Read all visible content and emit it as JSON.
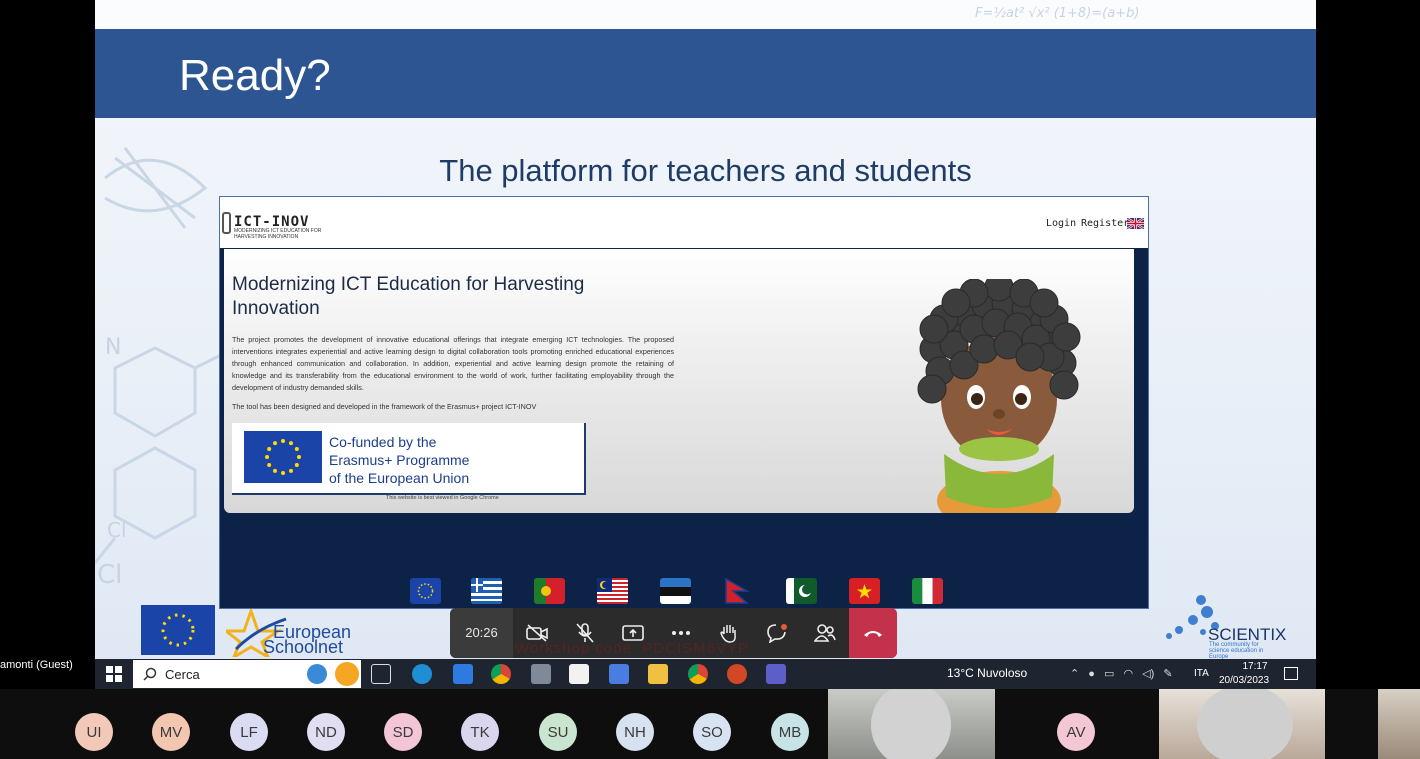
{
  "slide": {
    "title": "Ready?",
    "subtitle": "The platform for teachers and students",
    "decor": {
      "formula_top": "F=½at²  √x²  (1+8)=(a+b)",
      "chem_cl1": "Cl",
      "chem_cl2": "Cl",
      "chem_n": "N"
    }
  },
  "website": {
    "logo_title": "ICT-INOV",
    "logo_subtitle": "MODERNIZING ICT EDUCATION FOR HARVESTING INNOVATION",
    "nav": {
      "login": "Login",
      "register": "Register"
    },
    "hero": {
      "heading": "Modernizing ICT Education for Harvesting Innovation",
      "paragraph1": "The project promotes the development of innovative educational offerings that integrate emerging ICT technologies. The proposed interventions integrates experiential and active learning design to digital collaboration tools promoting enriched educational experiences through enhanced communication and collaboration. In addition, experiential and active learning design promote the retaining of knowledge and its transferability from the educational environment to the world of work, further facilitating employability through the development of industry demanded skills.",
      "paragraph2": "The tool has been designed and developed in the framework of the Erasmus+ project ICT-INOV",
      "cofund_line1": "Co-funded by the",
      "cofund_line2": "Erasmus+ Programme",
      "cofund_line3": "of the European Union",
      "note": "This website is best viewed in Google Chrome"
    },
    "flags": [
      "eu",
      "greece",
      "portugal",
      "malaysia",
      "estonia",
      "nepal",
      "pakistan",
      "vietnam",
      "italy"
    ]
  },
  "footer_logos": {
    "eun_line1": "European",
    "eun_line2": "Schoolnet",
    "scientix": "SCIENTIX",
    "scientix_tag": "The community for science education in Europe"
  },
  "meeting": {
    "timer": "20:26",
    "overlay_text": "Workshop code: PDCISM6VYP",
    "guest_label": "amonti (Guest)",
    "controls": [
      "camera-off-icon",
      "mic-off-icon",
      "share-screen-icon",
      "more-icon",
      "raise-hand-icon",
      "chat-icon",
      "people-icon",
      "hang-up-icon"
    ]
  },
  "taskbar": {
    "search_label": "Cerca",
    "weather": "13°C  Nuvoloso",
    "lang": "ITA",
    "time": "17:17",
    "date": "20/03/2023"
  },
  "participants": [
    {
      "initials": "UI",
      "color": "#f2c9b9"
    },
    {
      "initials": "MV",
      "color": "#f3c6b0"
    },
    {
      "initials": "LF",
      "color": "#d9dcf2"
    },
    {
      "initials": "ND",
      "color": "#e0def0"
    },
    {
      "initials": "SD",
      "color": "#f2c6d6"
    },
    {
      "initials": "TK",
      "color": "#d9d6ee"
    },
    {
      "initials": "SU",
      "color": "#c9e5cf"
    },
    {
      "initials": "NH",
      "color": "#d6e2f0"
    },
    {
      "initials": "SO",
      "color": "#d7e3f0"
    },
    {
      "initials": "MB",
      "color": "#c8e3e6"
    },
    {
      "initials": "AV",
      "color": "#f4c7d4"
    }
  ]
}
